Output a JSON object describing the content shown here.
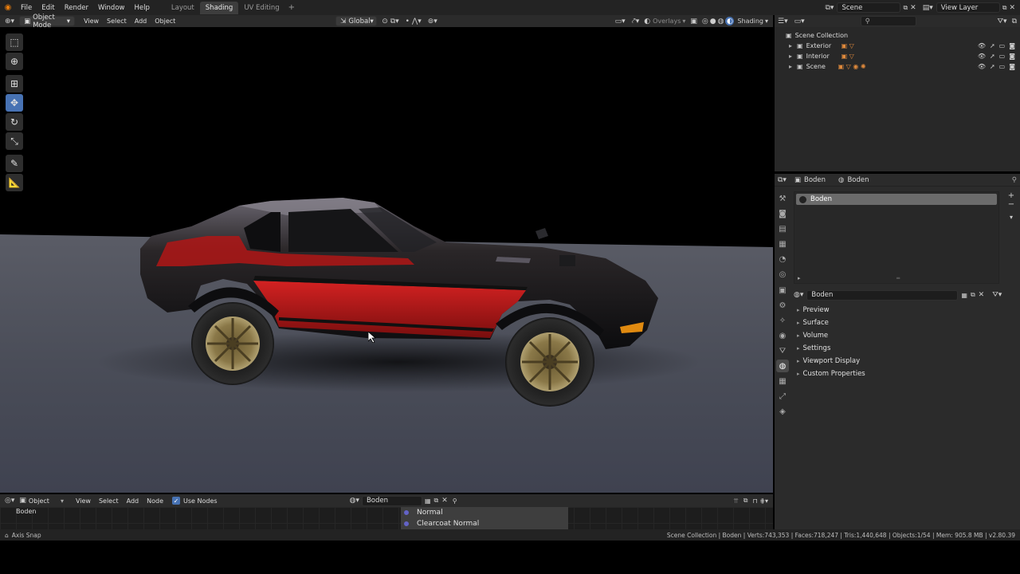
{
  "topbar": {
    "menus": [
      "File",
      "Edit",
      "Render",
      "Window",
      "Help"
    ],
    "workspaces": [
      {
        "label": "Layout",
        "active": false
      },
      {
        "label": "Shading",
        "active": true
      },
      {
        "label": "UV Editing",
        "active": false
      }
    ],
    "scene_name": "Scene",
    "view_layer": "View Layer"
  },
  "viewport_header": {
    "mode": "Object Mode",
    "menus": [
      "View",
      "Select",
      "Add",
      "Object"
    ],
    "orientation": "Global",
    "overlays_label": "Overlays",
    "shading_label": "Shading"
  },
  "outliner": {
    "root": "Scene Collection",
    "collections": [
      "Exterior",
      "Interior",
      "Scene"
    ],
    "search_placeholder": ""
  },
  "properties": {
    "breadcrumb_object": "Boden",
    "breadcrumb_material": "Boden",
    "slot_name": "Boden",
    "material_name": "Boden",
    "sections": [
      "Preview",
      "Surface",
      "Volume",
      "Settings",
      "Viewport Display",
      "Custom Properties"
    ]
  },
  "node_editor": {
    "object_label": "Object",
    "menus": [
      "View",
      "Select",
      "Add",
      "Node"
    ],
    "use_nodes_label": "Use Nodes",
    "use_nodes_checked": true,
    "material_name": "Boden",
    "corner_label": "Boden",
    "socket_labels": [
      "Normal",
      "Clearcoat Normal"
    ]
  },
  "statusbar": {
    "left": "Axis Snap",
    "right": "Scene Collection | Boden | Verts:743,353 | Faces:718,247 | Tris:1,440,648 | Objects:1/54 | Mem: 905.8 MB | v2.80.39"
  },
  "colors": {
    "accent": "#4772b3",
    "car_red": "#b01616",
    "car_black": "#111111",
    "floor": "#4a4d58"
  }
}
